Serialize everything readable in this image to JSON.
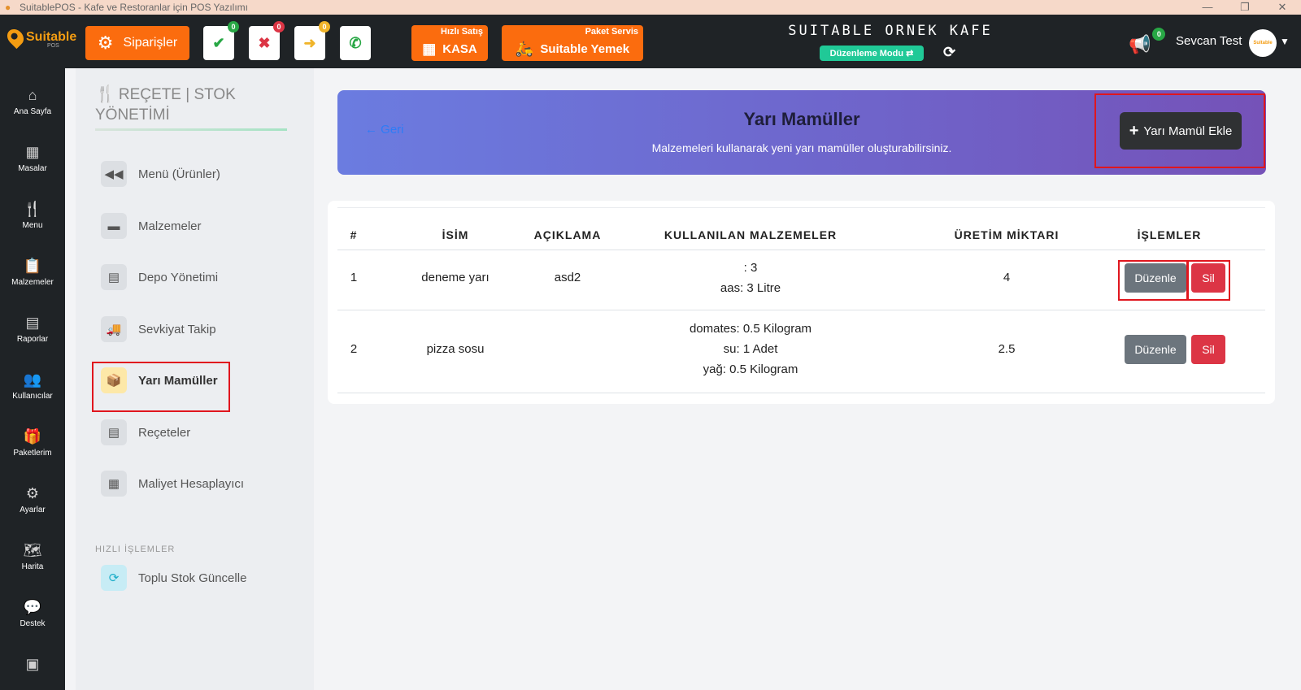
{
  "window": {
    "title": "SuitablePOS - Kafe ve Restoranlar için POS Yazılımı",
    "controls": [
      "—",
      "❐",
      "✕"
    ]
  },
  "header": {
    "logo_text": "Suitable",
    "logo_sub": "POS",
    "orders_label": "Siparişler",
    "status_buttons": [
      {
        "icon": "check-icon",
        "glyph": "✔",
        "color": "#28a745",
        "badge": "0",
        "badge_color": "#28a745"
      },
      {
        "icon": "x-icon",
        "glyph": "✖",
        "color": "#dc3545",
        "badge": "0",
        "badge_color": "#dc3545"
      },
      {
        "icon": "arrow-right-icon",
        "glyph": "➜",
        "color": "#f0b429",
        "badge": "0",
        "badge_color": "#f0b429"
      },
      {
        "icon": "phone-icon",
        "glyph": "✆",
        "color": "#28a745",
        "badge": "",
        "badge_color": ""
      }
    ],
    "quick_sale_small": "Hızlı Satış",
    "quick_sale_label": "KASA",
    "package_small": "Paket Servis",
    "package_label": "Suitable Yemek",
    "cafe_name": "SUITABLE ORNEK KAFE",
    "edit_mode": "Düzenleme Modu ⇄",
    "notifications_badge": "0",
    "user_name": "Sevcan Test",
    "avatar_text": "Suitable"
  },
  "leftnav": [
    {
      "name": "home",
      "label": "Ana Sayfa",
      "glyph": "⌂"
    },
    {
      "name": "tables",
      "label": "Masalar",
      "glyph": "▦"
    },
    {
      "name": "menu",
      "label": "Menu",
      "glyph": "🍴"
    },
    {
      "name": "ingredients",
      "label": "Malzemeler",
      "glyph": "📋"
    },
    {
      "name": "reports",
      "label": "Raporlar",
      "glyph": "▤"
    },
    {
      "name": "users",
      "label": "Kullanıcılar",
      "glyph": "👥"
    },
    {
      "name": "packages",
      "label": "Paketlerim",
      "glyph": "🎁"
    },
    {
      "name": "settings",
      "label": "Ayarlar",
      "glyph": "⚙"
    },
    {
      "name": "map",
      "label": "Harita",
      "glyph": "🗺"
    },
    {
      "name": "support",
      "label": "Destek",
      "glyph": "💬"
    }
  ],
  "subnav": {
    "title": "REÇETE | STOK YÖNETİMİ",
    "items": [
      {
        "name": "menu-products",
        "label": "Menü (Ürünler)",
        "glyph": "◀◀"
      },
      {
        "name": "ingredients",
        "label": "Malzemeler",
        "glyph": "▬"
      },
      {
        "name": "warehouse",
        "label": "Depo Yönetimi",
        "glyph": "▤"
      },
      {
        "name": "shipment-tracking",
        "label": "Sevkiyat Takip",
        "glyph": "🚚"
      },
      {
        "name": "semi-products",
        "label": "Yarı Mamüller",
        "glyph": "📦"
      },
      {
        "name": "recipes",
        "label": "Reçeteler",
        "glyph": "▤"
      },
      {
        "name": "cost-calculator",
        "label": "Maliyet Hesaplayıcı",
        "glyph": "▦"
      }
    ],
    "quick_heading": "HIZLI İŞLEMLER",
    "quick_items": [
      {
        "name": "bulk-stock-update",
        "label": "Toplu Stok Güncelle",
        "glyph": "⟳"
      }
    ]
  },
  "banner": {
    "back_label": "Geri",
    "title": "Yarı Mamüller",
    "subtitle": "Malzemeleri kullanarak yeni yarı mamüller oluşturabilirsiniz.",
    "add_label": "Yarı Mamül Ekle"
  },
  "table": {
    "headers": [
      "#",
      "İSİM",
      "AÇIKLAMA",
      "KULLANILAN MALZEMELER",
      "ÜRETİM MİKTARI",
      "İŞLEMLER"
    ],
    "rows": [
      {
        "no": "1",
        "name": "deneme yarı",
        "description": "asd2",
        "ingredients": [
          ": 3",
          "aas: 3 Litre"
        ],
        "quantity": "4",
        "edit": "Düzenle",
        "delete": "Sil"
      },
      {
        "no": "2",
        "name": "pizza sosu",
        "description": "",
        "ingredients": [
          "domates: 0.5 Kilogram",
          "su: 1 Adet",
          "yağ: 0.5 Kilogram"
        ],
        "quantity": "2.5",
        "edit": "Düzenle",
        "delete": "Sil"
      }
    ]
  }
}
